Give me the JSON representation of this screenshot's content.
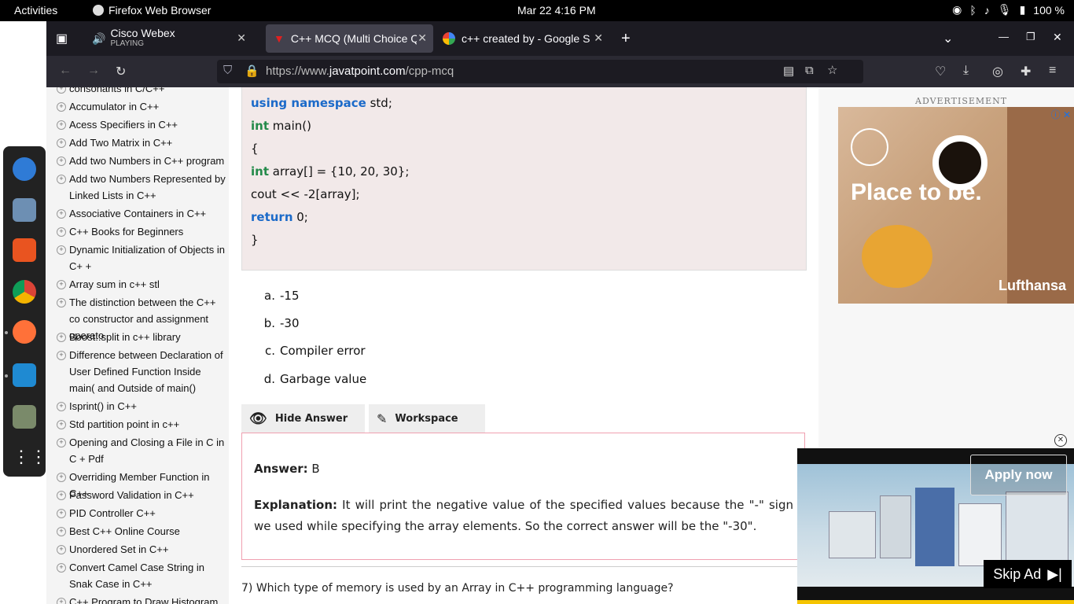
{
  "topbar": {
    "activities": "Activities",
    "app_name": "Firefox Web Browser",
    "clock": "Mar 22  4:16 PM",
    "battery": "100 %"
  },
  "tabs": [
    {
      "title": "Cisco Webex",
      "subtitle": "PLAYING"
    },
    {
      "title": "C++ MCQ (Multi Choice Q"
    },
    {
      "title": "c++ created by - Google S"
    }
  ],
  "urlbar": {
    "prefix": "https://www.",
    "domain": "javatpoint.com",
    "path": "/cpp-mcq"
  },
  "sidebar": {
    "items": [
      "consonants in C/C++",
      "Accumulator in C++",
      "Acess Specifiers in C++",
      "Add Two Matrix in C++",
      "Add two Numbers in C++ program",
      "Add two Numbers Represented by Linked Lists in C++",
      "Associative Containers in C++",
      "C++ Books for Beginners",
      "Dynamic Initialization of Objects in C+ +",
      "Array sum in c++ stl",
      "The distinction between the C++ co constructor and assignment operato",
      "Boost::split in c++ library",
      "Difference between Declaration of User Defined Function Inside main( and Outside of main()",
      "Isprint() in C++",
      "Std partition point in c++",
      "Opening and Closing a File in C in C + Pdf",
      "Overriding Member Function in C++",
      "Password Validation in C++",
      "PID Controller C++",
      "Best C++ Online Course",
      "Unordered Set in C++",
      "Convert Camel Case String in Snak Case in C++",
      "C++ Program to Draw Histogram"
    ]
  },
  "code": {
    "line1_kw": "using namespace",
    "line1_rest": " std;",
    "line2_kw": "int",
    "line2_rest": " main()",
    "line3": "{",
    "line4_kw": "int",
    "line4_rest": " array[] = {10, 20, 30};",
    "line5": "cout << -2[array];",
    "line6_kw": "return",
    "line6_rest": " 0;",
    "line7": "}"
  },
  "options": [
    {
      "letter": "a.",
      "text": "-15"
    },
    {
      "letter": "b.",
      "text": "-30"
    },
    {
      "letter": "c.",
      "text": "Compiler error"
    },
    {
      "letter": "d.",
      "text": "Garbage value"
    }
  ],
  "buttons": {
    "hide_answer": "Hide Answer",
    "workspace": "Workspace"
  },
  "answer": {
    "label": "Answer:",
    "value": " B",
    "exp_label": "Explanation:",
    "exp_text": " It will print the negative value of the specified values because the \"-\" sign we used while specifying the array elements. So the correct answer will be the \"-30\"."
  },
  "next_question": "7) Which type of memory is used by an Array in C++ programming language?",
  "ads": {
    "label": "ADVERTISEMENT",
    "headline": "Place to be.",
    "brand": "Lufthansa",
    "apply": "Apply now",
    "skip": "Skip Ad"
  }
}
